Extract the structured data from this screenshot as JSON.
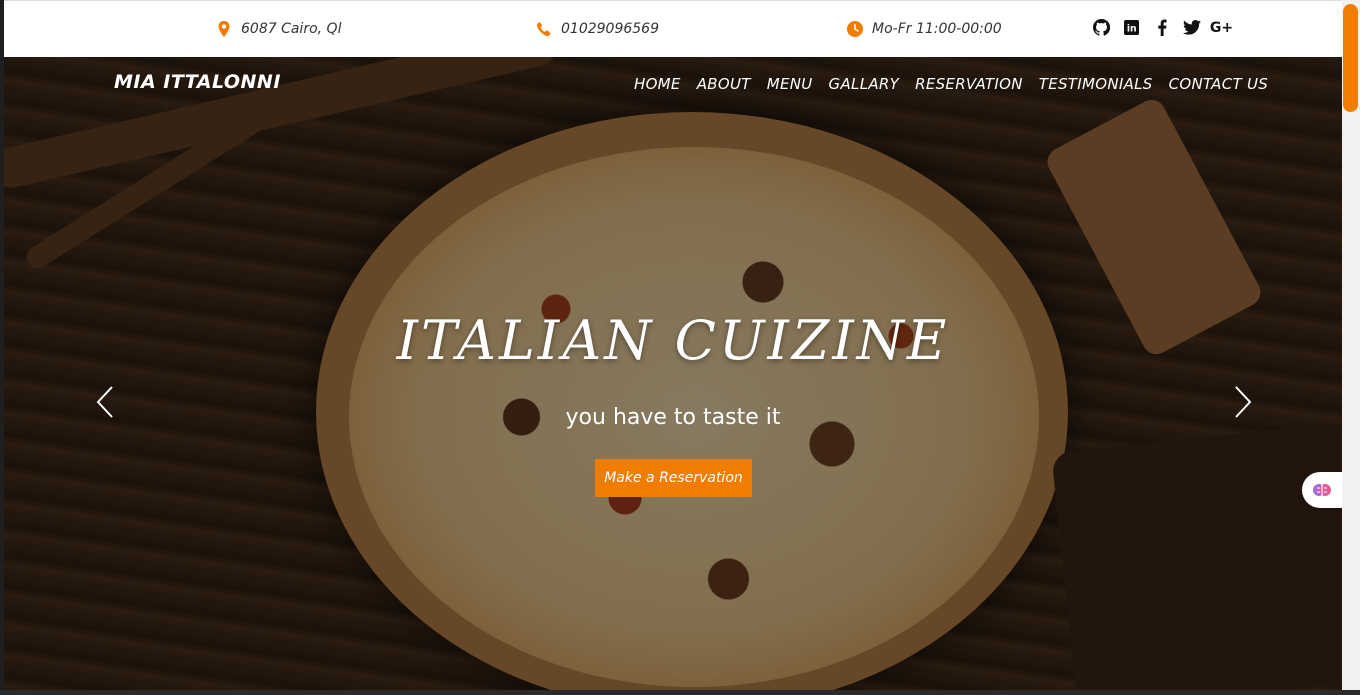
{
  "topbar": {
    "address": "6087 Cairo, Ql",
    "phone": "01029096569",
    "hours": "Mo-Fr 11:00-00:00",
    "accent": "#f07c00",
    "social": [
      {
        "icon": "github-icon",
        "glyph": "●"
      },
      {
        "icon": "linkedin-icon",
        "glyph": "in"
      },
      {
        "icon": "facebook-icon",
        "glyph": "f"
      },
      {
        "icon": "twitter-icon",
        "glyph": "✦"
      },
      {
        "icon": "google-plus-icon",
        "glyph": "G+"
      }
    ]
  },
  "nav": {
    "brand": "MIA ITTALONNI",
    "items": [
      "HOME",
      "ABOUT",
      "MENU",
      "GALLARY",
      "RESERVATION",
      "TESTIMONIALS",
      "CONTACT US"
    ]
  },
  "hero": {
    "title": "ITALIAN CUIZINE",
    "subtitle": "you have to taste it",
    "cta_label": "Make a Reservation"
  },
  "icons": {
    "prev": "chevron-left-icon",
    "next": "chevron-right-icon",
    "floating": "brain-icon"
  }
}
